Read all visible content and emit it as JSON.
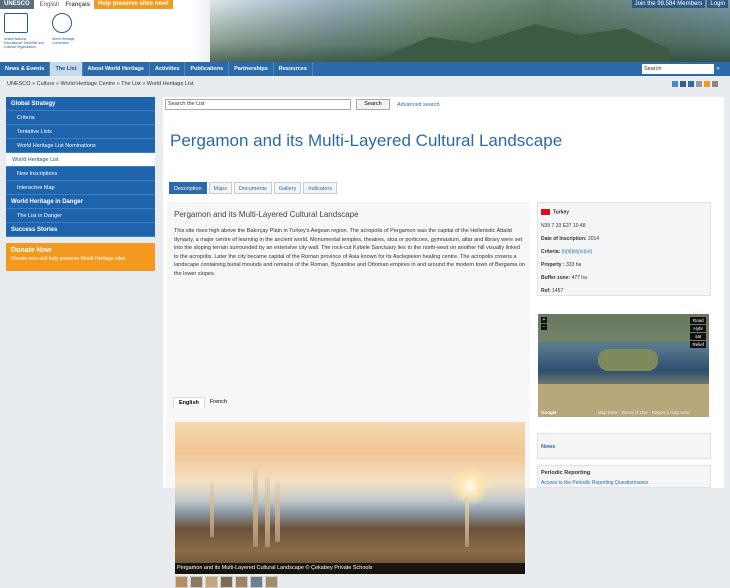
{
  "topbar": {
    "unesco": "UNESCO",
    "languages": [
      "English",
      "Français"
    ],
    "help": "Help preserve sites now!",
    "join": "Join the 98,584 Members",
    "login": "Login",
    "logo_text_1": "United Nations Educational, Scientific and Cultural Organization",
    "logo_text_2": "World Heritage Convention"
  },
  "nav": {
    "items": [
      "News & Events",
      "The List",
      "About World Heritage",
      "Activities",
      "Publications",
      "Partnerships",
      "Resources"
    ],
    "search_placeholder": "Search",
    "search_button": "»"
  },
  "breadcrumb": "UNESCO » Culture » World Heritage Centre » The List » World Heritage List",
  "sidebar": {
    "sections": [
      {
        "title": "Global Strategy",
        "items": [
          "Criteria",
          "Tentative Lists",
          "World Heritage List Nominations"
        ]
      },
      {
        "title": "World Heritage List",
        "items": [
          "New Inscriptions",
          "Interactive Map"
        ]
      },
      {
        "title": "World Heritage in Danger",
        "items": [
          "The List in Danger"
        ]
      },
      {
        "title": "Success Stories",
        "items": []
      }
    ],
    "donate_title": "Donate Now",
    "donate_sub": "Donate now and help preserve World Heritage sites"
  },
  "search_list": {
    "placeholder": "Search the List",
    "button": "Search",
    "advanced": "Advanced search"
  },
  "page": {
    "title": "Pergamon and its Multi-Layered Cultural Landscape",
    "tabs": [
      "Description",
      "Maps",
      "Documents",
      "Gallery",
      "Indicators"
    ],
    "content_title": "Pergamon and its Multi-Layered Cultural Landscape",
    "description": "This site rises high above the Bakırçay Plain in Turkey's Aegean region. The acropolis of Pergamon was the capital of the Hellenistic Attalid dynasty, a major centre of learning in the ancient world. Monumental temples, theatres, stoa or porticoes, gymnasium, altar and library were set into the sloping terrain surrounded by an extensive city wall. The rock-cut Kybele Sanctuary lies to the north-west on another hill visually linked to the acropolis. Later the city became capital of the Roman province of Asia known for its Asclepieion healing centre. The acropolis crowns a landscape containing burial mounds and remains of the Roman, Byzantine and Ottoman empires in and around the modern town of Bergama on the lower slopes.",
    "lang_tabs": [
      "English",
      "French"
    ],
    "photo_caption": "Pergamon and its Multi-Layered Cultural Landscape © Çekabey Private Schools"
  },
  "info": {
    "country": "Turkey",
    "coords": "N39 7 33 E27 10 48",
    "date_label": "Date of Inscription:",
    "date": "2014",
    "criteria_label": "Criteria:",
    "criteria": "(i)(ii)(iii)(iv)(vi)",
    "property_label": "Property :",
    "property": "333 ha",
    "buffer_label": "Buffer zone:",
    "buffer": "477 ha",
    "ref_label": "Ref:",
    "ref": "1457"
  },
  "map": {
    "modes": [
      "Road",
      "Hybr",
      "sat",
      "Relief"
    ],
    "footer": [
      "Google",
      "Map Data",
      "Terms of Use",
      "Report a map error"
    ]
  },
  "news_title": "News",
  "periodic": {
    "title": "Periodic Reporting",
    "link": "Access to the Periodic Reporting Questionnaires"
  },
  "colors": {
    "primary": "#2c6ba9",
    "accent": "#f39a1e",
    "sidebar": "#1e64ad"
  }
}
